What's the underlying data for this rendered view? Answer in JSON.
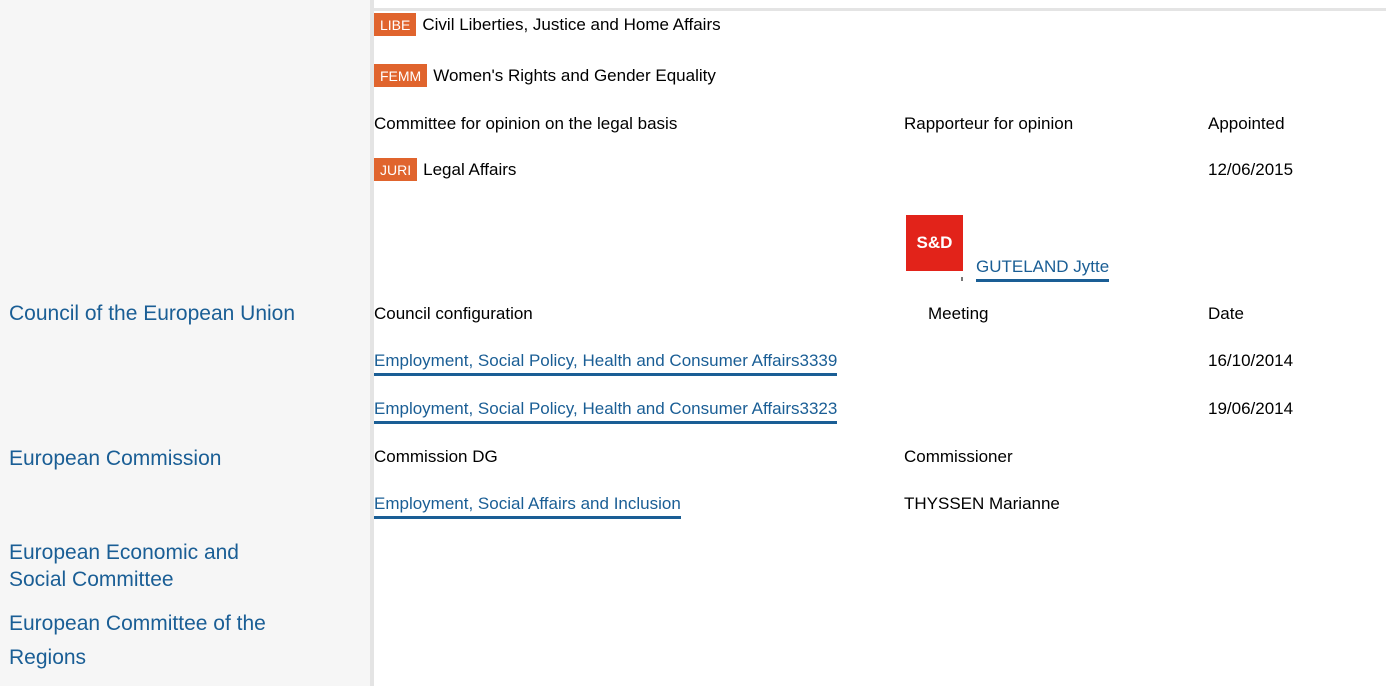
{
  "committees": [
    {
      "code": "LIBE",
      "name": "Civil Liberties, Justice and Home Affairs"
    },
    {
      "code": "FEMM",
      "name": "Women's Rights and Gender Equality"
    }
  ],
  "legal_basis": {
    "headers": {
      "committee": "Committee for opinion on the legal basis",
      "rapporteur": "Rapporteur for opinion",
      "appointed": "Appointed"
    },
    "row": {
      "code": "JURI",
      "name": "Legal Affairs",
      "appointed": "12/06/2015"
    },
    "rapporteur": {
      "group_logo": "S&D",
      "name": "GUTELAND Jytte"
    }
  },
  "council": {
    "institution": "Council of the European Union",
    "headers": {
      "configuration": "Council configuration",
      "meeting": "Meeting",
      "date": "Date"
    },
    "rows": [
      {
        "configuration_meeting": "Employment, Social Policy, Health and Consumer Affairs3339",
        "date": "16/10/2014"
      },
      {
        "configuration_meeting": "Employment, Social Policy, Health and Consumer Affairs3323",
        "date": "19/06/2014"
      }
    ]
  },
  "commission": {
    "institution": "European Commission",
    "headers": {
      "dg": "Commission DG",
      "commissioner": "Commissioner"
    },
    "row": {
      "dg": "Employment, Social Affairs and Inclusion",
      "commissioner": "THYSSEN Marianne"
    }
  },
  "other_institutions": [
    {
      "line1": "European Economic and",
      "line2": "Social Committee"
    },
    {
      "line1": "European Committee of the",
      "line2": "Regions"
    }
  ],
  "colors": {
    "badge": "#e0642d",
    "link": "#1a5e95",
    "group_logo": "#e2231a",
    "sidebar_bg": "#f6f6f6"
  }
}
